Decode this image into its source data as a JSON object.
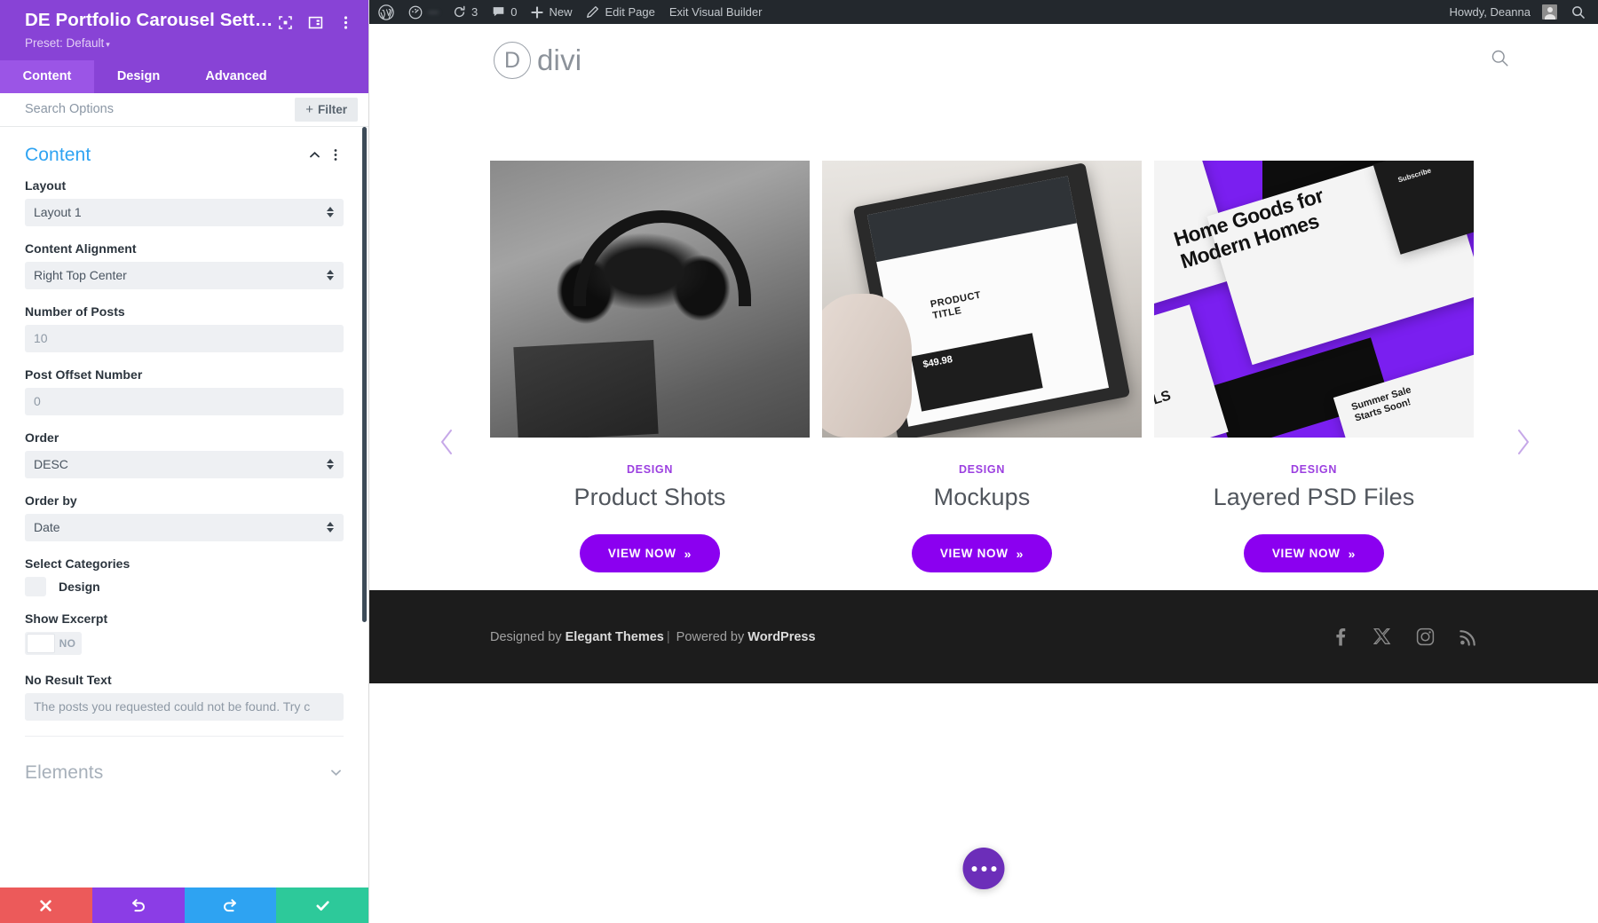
{
  "settings_panel": {
    "title": "DE Portfolio Carousel Setti…",
    "preset": "Preset: Default",
    "titlebar_icons": [
      "expand-icon",
      "layout-toggle-icon",
      "more-vertical-icon"
    ],
    "tabs": [
      {
        "label": "Content",
        "active": true
      },
      {
        "label": "Design",
        "active": false
      },
      {
        "label": "Advanced",
        "active": false
      }
    ],
    "search": {
      "placeholder": "Search Options",
      "value": ""
    },
    "filter_button": "Filter",
    "sections": [
      {
        "title": "Content",
        "state": "expanded"
      },
      {
        "title": "Elements",
        "state": "collapsed"
      }
    ],
    "fields": {
      "layout": {
        "label": "Layout",
        "value": "Layout 1",
        "type": "select"
      },
      "content_alignment": {
        "label": "Content Alignment",
        "value": "Right Top Center",
        "type": "select"
      },
      "number_of_posts": {
        "label": "Number of Posts",
        "value": "10",
        "type": "number"
      },
      "post_offset_number": {
        "label": "Post Offset Number",
        "value": "0",
        "type": "number"
      },
      "order": {
        "label": "Order",
        "value": "DESC",
        "type": "select"
      },
      "order_by": {
        "label": "Order by",
        "value": "Date",
        "type": "select"
      },
      "select_categories": {
        "label": "Select Categories",
        "options": [
          {
            "label": "Design",
            "checked": false
          }
        ]
      },
      "show_excerpt": {
        "label": "Show Excerpt",
        "value": "NO",
        "state": "off"
      },
      "no_result_text": {
        "label": "No Result Text",
        "value": "The posts you requested could not be found. Try c"
      }
    },
    "footer_buttons": [
      {
        "name": "discard-changes",
        "icon": "x-icon",
        "color": "#ec5a5a"
      },
      {
        "name": "undo",
        "icon": "undo-icon",
        "color": "#8b3de6"
      },
      {
        "name": "redo",
        "icon": "redo-icon",
        "color": "#2ea3f2"
      },
      {
        "name": "save-changes",
        "icon": "check-icon",
        "color": "#2dc99a"
      }
    ]
  },
  "admin_bar": {
    "wp_logo": "wordpress-logo-icon",
    "site_name": "",
    "updates": {
      "icon": "updates-icon",
      "count": "3"
    },
    "comments": {
      "icon": "comment-icon",
      "count": "0"
    },
    "new": {
      "icon": "plus-icon",
      "label": "New"
    },
    "edit_page": {
      "icon": "pencil-icon",
      "label": "Edit Page"
    },
    "exit_visual_builder": "Exit Visual Builder",
    "howdy": "Howdy, Deanna",
    "search_icon": "search-icon"
  },
  "preview": {
    "header": {
      "logo_letter": "D",
      "logo_word": "divi",
      "search_icon": "search-icon"
    },
    "carousel": {
      "prev_arrow": "chevron-left-icon",
      "next_arrow": "chevron-right-icon",
      "items": [
        {
          "category": "DESIGN",
          "title": "Product Shots",
          "button": "VIEW NOW",
          "button_chevron": "»",
          "image": "headphones-photo"
        },
        {
          "category": "DESIGN",
          "title": "Mockups",
          "button": "VIEW NOW",
          "button_chevron": "»",
          "image": "tablet-mockup-photo"
        },
        {
          "category": "DESIGN",
          "title": "Layered PSD Files",
          "button": "VIEW NOW",
          "button_chevron": "»",
          "image": "psd-layouts-photo"
        }
      ],
      "image_text": {
        "tablet": {
          "product_title_line1": "PRODUCT",
          "product_title_line2": "TITLE",
          "price": "$49.98"
        },
        "psd": {
          "headline_line1": "Home Goods for",
          "headline_line2": "Modern Homes",
          "subscribe": "Subscribe",
          "arrivals": "VALS",
          "summer_line1": "Summer Sale",
          "summer_line2": "Starts Soon!"
        }
      }
    },
    "footer": {
      "credit_prefix": "Designed by ",
      "credit_brand": "Elegant Themes",
      "credit_sep": "|",
      "credit_mid": " Powered by ",
      "credit_cms": "WordPress",
      "social": [
        "facebook-icon",
        "x-twitter-icon",
        "instagram-icon",
        "rss-icon"
      ]
    },
    "fab": "more-options-fab"
  },
  "colors": {
    "panel_purple": "#8843d6",
    "panel_tab_active": "#9b55e6",
    "divi_blue": "#2ea3f2",
    "accent_purple": "#8b00f0",
    "category_purple": "#9b3fe0",
    "admin_bar": "#23282d",
    "footer_bg": "#1c1c1c"
  }
}
